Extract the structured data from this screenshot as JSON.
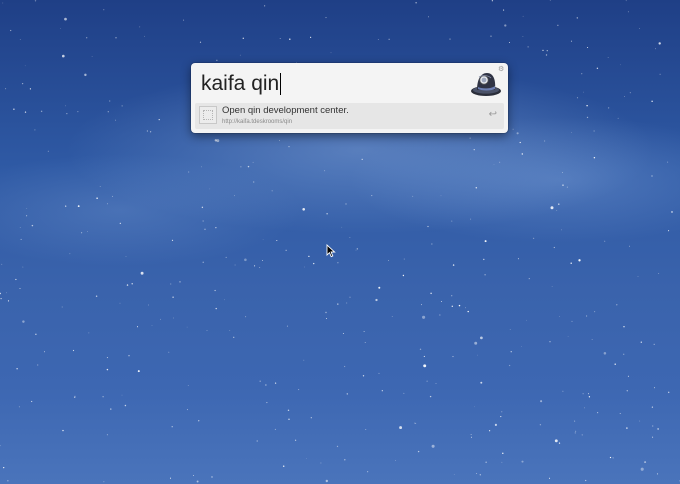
{
  "alfred": {
    "query": "kaifa qin",
    "result": {
      "title": "Open qin development center.",
      "subtitle": "http://kaifa.tdeskrooms/qin"
    }
  },
  "icons": {
    "app": "alfred-hat-icon",
    "settings": "gear-icon",
    "result": "web-placeholder-icon",
    "action": "return-key-icon",
    "pointer": "mouse-cursor-icon"
  }
}
